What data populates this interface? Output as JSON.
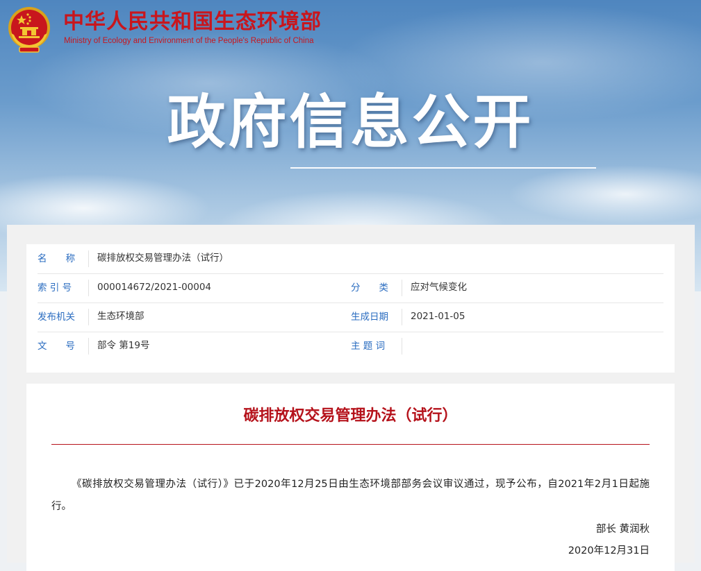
{
  "site": {
    "name_cn": "中华人民共和国生态环境部",
    "name_en": "Ministry of Ecology and Environment of the People's Republic of China",
    "emblem_icon": "national-emblem-icon"
  },
  "banner": {
    "heading": "政府信息公开"
  },
  "colors": {
    "brand_red": "#c8161d",
    "label_blue": "#2a6cc0",
    "title_red": "#b5121b"
  },
  "meta": {
    "name_label": "名　　称",
    "name_value": "碳排放权交易管理办法（试行）",
    "index_label": "索 引 号",
    "index_value": "000014672/2021-00004",
    "category_label": "分　　类",
    "category_value": "应对气候变化",
    "issuer_label": "发布机关",
    "issuer_value": "生态环境部",
    "date_label": "生成日期",
    "date_value": "2021-01-05",
    "docno_label": "文　　号",
    "docno_value": "部令 第19号",
    "subject_label": "主 题 词",
    "subject_value": ""
  },
  "document": {
    "title": "碳排放权交易管理办法（试行）",
    "body": "《碳排放权交易管理办法（试行）》已于2020年12月25日由生态环境部部务会议审议通过，现予公布，自2021年2月1日起施行。",
    "signer": "部长 黄润秋",
    "date": "2020年12月31日"
  }
}
